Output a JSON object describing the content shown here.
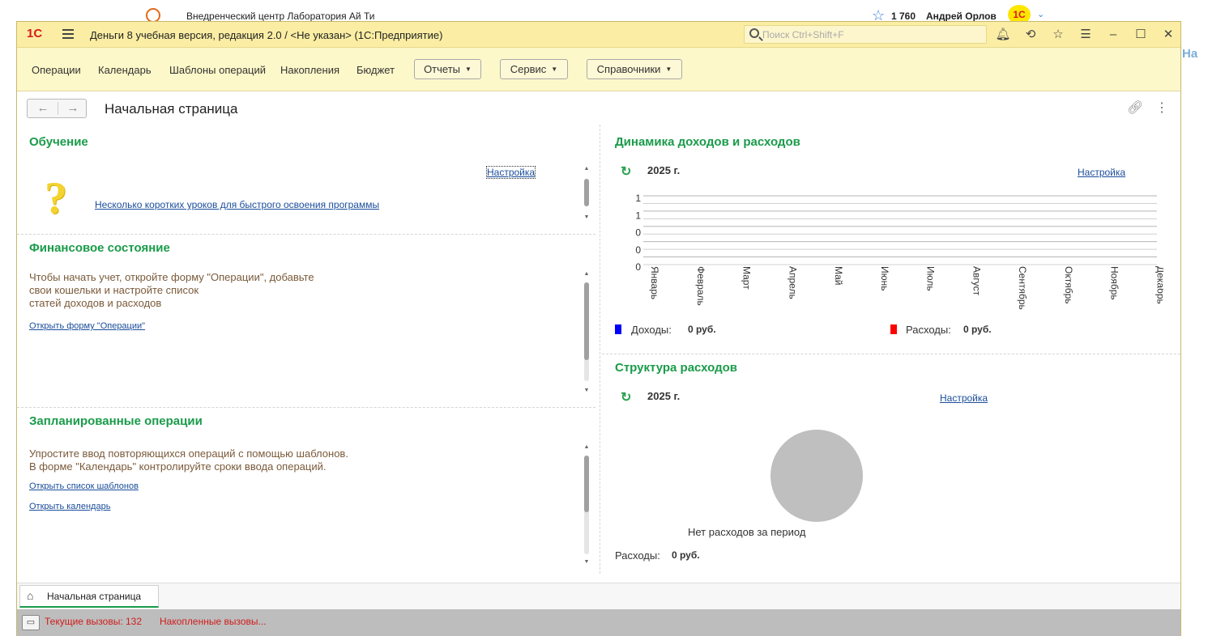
{
  "background": {
    "company": "Внедренческий центр Лаборатория Ай Ти",
    "count": "1 760",
    "user": "Андрей Орлов",
    "right_fragment": "Ha"
  },
  "window": {
    "title": "Деньги 8 учебная версия, редакция 2.0 / <Не указан>  (1С:Предприятие)",
    "search_placeholder": "Поиск Ctrl+Shift+F"
  },
  "menu": {
    "items": [
      "Операции",
      "Календарь",
      "Шаблоны операций",
      "Накопления",
      "Бюджет"
    ],
    "dropdowns": [
      "Отчеты",
      "Сервис",
      "Справочники"
    ]
  },
  "page": {
    "title": "Начальная страница"
  },
  "learning": {
    "title": "Обучение",
    "settings": "Настройка",
    "lessons_link": "Несколько коротких уроков для быстрого освоения программы"
  },
  "finance": {
    "title": "Финансовое состояние",
    "text": [
      "Чтобы начать учет, откройте форму \"Операции\", добавьте",
      "свои кошельки и настройте список",
      "статей доходов и расходов"
    ],
    "link": "Открыть форму \"Операции\""
  },
  "planned": {
    "title": "Запланированные операции",
    "text": [
      "Упростите ввод повторяющихся операций с помощью шаблонов.",
      "В форме \"Календарь\" контролируйте сроки ввода операций."
    ],
    "link_templates": "Открыть список шаблонов",
    "link_calendar": "Открыть календарь"
  },
  "dynamics": {
    "title": "Динамика доходов и расходов",
    "year": "2025 г.",
    "settings": "Настройка",
    "income_label": "Доходы:",
    "income_value": "0 руб.",
    "expense_label": "Расходы:",
    "expense_value": "0 руб."
  },
  "structure": {
    "title": "Структура расходов",
    "year": "2025 г.",
    "settings": "Настройка",
    "no_data": "Нет расходов за период",
    "expense_label": "Расходы:",
    "expense_value": "0 руб."
  },
  "chart_data": {
    "type": "line",
    "categories": [
      "Январь",
      "Февраль",
      "Март",
      "Апрель",
      "Май",
      "Июнь",
      "Июль",
      "Август",
      "Сентябрь",
      "Октябрь",
      "Ноябрь",
      "Декабрь"
    ],
    "y_tick_labels": [
      "1",
      "1",
      "0",
      "0",
      "0"
    ],
    "series": [
      {
        "name": "Доходы",
        "color": "#0000ff",
        "values": [
          0,
          0,
          0,
          0,
          0,
          0,
          0,
          0,
          0,
          0,
          0,
          0
        ]
      },
      {
        "name": "Расходы",
        "color": "#ff0000",
        "values": [
          0,
          0,
          0,
          0,
          0,
          0,
          0,
          0,
          0,
          0,
          0,
          0
        ]
      }
    ],
    "grid": true
  },
  "tabs": [
    {
      "label": "Начальная страница"
    }
  ],
  "status": {
    "current_calls": "Текущие вызовы: 132",
    "accumulated": "Накопленные вызовы..."
  },
  "colors": {
    "accent_green": "#1a9b4a",
    "title_bar": "#fbeea4",
    "menu_bar": "#fdf8c9",
    "status_red": "#d01d1d",
    "income": "#0000ff",
    "expense": "#ff0000"
  }
}
